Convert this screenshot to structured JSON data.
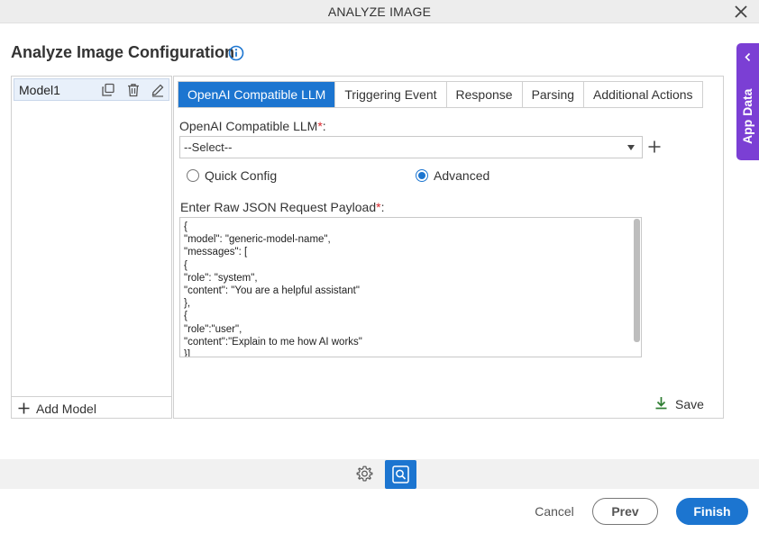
{
  "window": {
    "title": "ANALYZE IMAGE",
    "close_icon": "close-icon"
  },
  "header": {
    "title": "Analyze Image Configuration",
    "info_icon": "info-icon"
  },
  "side_panel": {
    "label": "App Data",
    "color": "#7b3fd4"
  },
  "models": {
    "items": [
      {
        "label": "Model1",
        "selected": true
      }
    ],
    "add_label": "Add Model"
  },
  "tabs": [
    {
      "label": "OpenAI Compatible LLM",
      "active": true
    },
    {
      "label": "Triggering Event",
      "active": false
    },
    {
      "label": "Response",
      "active": false
    },
    {
      "label": "Parsing",
      "active": false
    },
    {
      "label": "Additional Actions",
      "active": false
    }
  ],
  "form": {
    "llm_label": "OpenAI Compatible LLM",
    "required_mark": "*",
    "label_suffix": ":",
    "llm_select_value": "--Select--",
    "config_options": [
      {
        "label": "Quick Config",
        "checked": false
      },
      {
        "label": "Advanced",
        "checked": true
      }
    ],
    "payload_label": "Enter Raw JSON Request Payload",
    "payload_text": "{\n\"model\": \"generic-model-name\",\n\"messages\": [\n{\n\"role\": \"system\",\n\"content\": \"You are a helpful assistant\"\n},\n{\n\"role\":\"user\",\n\"content\":\"Explain to me how AI works\"\n}]",
    "save_label": "Save"
  },
  "footer": {
    "cancel_label": "Cancel",
    "prev_label": "Prev",
    "finish_label": "Finish"
  },
  "colors": {
    "accent": "#1c75d0",
    "required": "#d9262c",
    "save_icon": "#2e7d32"
  }
}
